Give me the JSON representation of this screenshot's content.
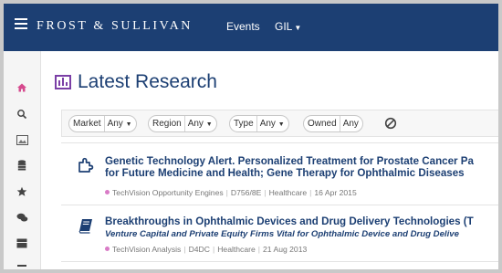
{
  "header": {
    "brand": "FROST & SULLIVAN",
    "nav": [
      {
        "label": "Events"
      },
      {
        "label": "GIL"
      }
    ]
  },
  "sidebar": {
    "icons": [
      "home-icon",
      "search-icon",
      "image-icon",
      "database-icon",
      "star-icon",
      "chat-icon",
      "inbox-icon",
      "more-icon"
    ]
  },
  "main": {
    "title": "Latest Research",
    "filters": [
      {
        "label": "Market",
        "value": "Any"
      },
      {
        "label": "Region",
        "value": "Any"
      },
      {
        "label": "Type",
        "value": "Any"
      },
      {
        "label": "Owned",
        "value": "Any"
      }
    ],
    "results": [
      {
        "title_line1": "Genetic Technology Alert. Personalized Treatment for Prostate Cancer Pa",
        "title_line2": "for Future Medicine and Health; Gene Therapy for Ophthalmic Diseases",
        "subtitle": "",
        "source": "TechVision Opportunity Engines",
        "code": "D756/8E",
        "sector": "Healthcare",
        "date": "16 Apr 2015",
        "icon": "puzzle-icon"
      },
      {
        "title_line1": "Breakthroughs in Ophthalmic Devices and Drug Delivery Technologies (T",
        "title_line2": "",
        "subtitle": "Venture Capital and Private Equity Firms Vital for Ophthalmic Device and Drug Delive",
        "source": "TechVision Analysis",
        "code": "D4DC",
        "sector": "Healthcare",
        "date": "21 Aug 2013",
        "icon": "book-icon"
      }
    ]
  },
  "colors": {
    "header_bg": "#1c3f73",
    "accent": "#7b3fa6",
    "dot": "#d97bc6"
  }
}
